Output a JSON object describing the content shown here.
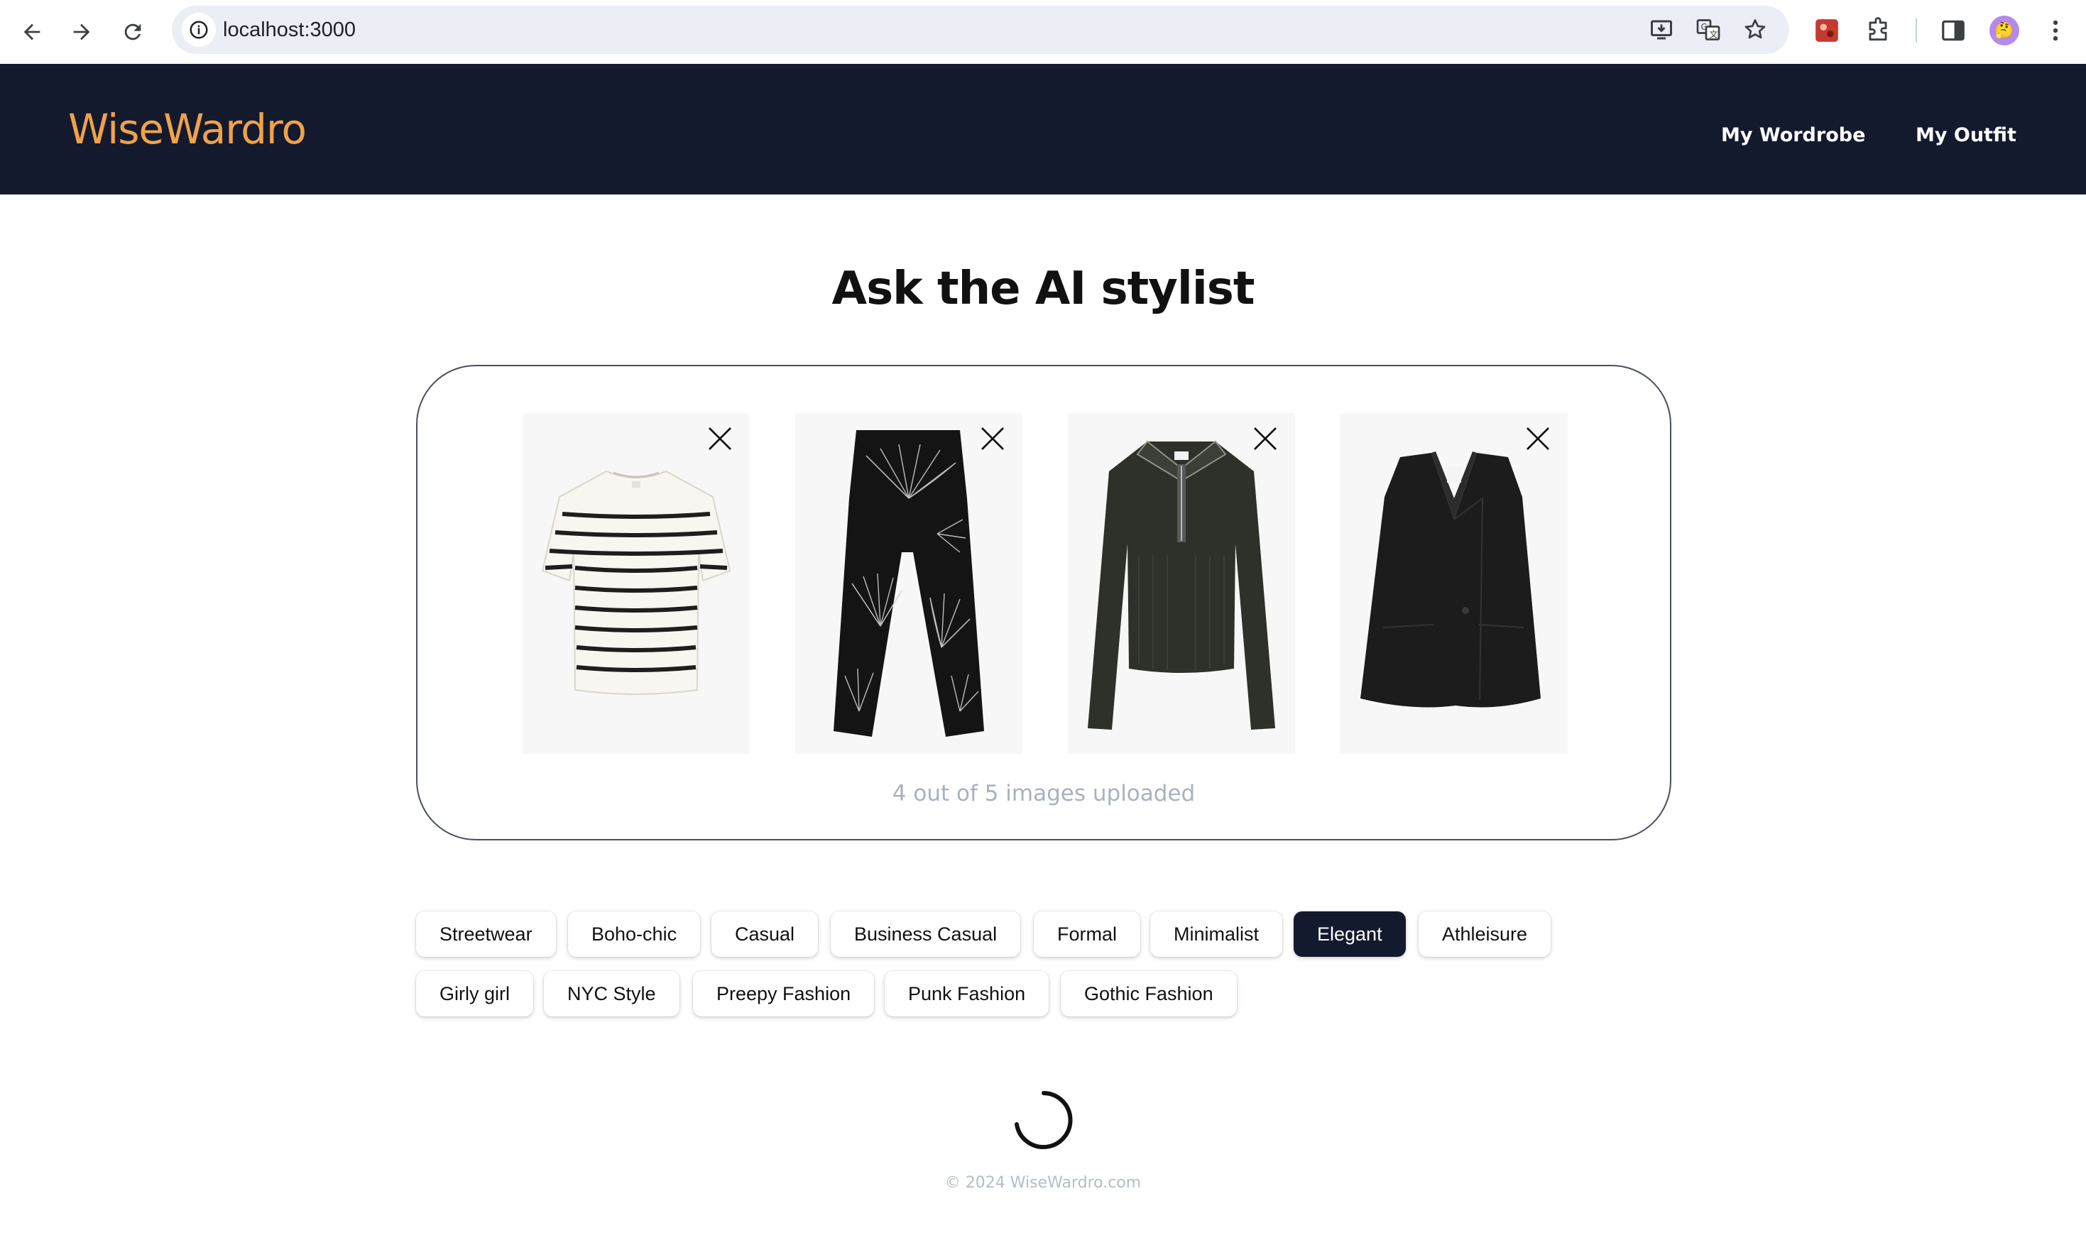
{
  "browser": {
    "url": "localhost:3000",
    "back_icon": "arrow-left-icon",
    "forward_icon": "arrow-right-icon",
    "reload_icon": "reload-icon",
    "site_info_icon": "info-icon",
    "install_icon": "install-app-icon",
    "translate_icon": "translate-icon",
    "bookmark_icon": "star-icon",
    "extension_icon": "puzzle-icon",
    "sidepanel_icon": "side-panel-icon",
    "menu_icon": "kebab-menu-icon",
    "profile_avatar": "🤔"
  },
  "header": {
    "brand": "WiseWardro",
    "brand_color": "#f0a24a",
    "background": "#141a2e",
    "nav": [
      "My Wordrobe",
      "My Outfit"
    ]
  },
  "main": {
    "title": "Ask the AI stylist",
    "uploaded_items": [
      {
        "name": "striped-knit-tshirt",
        "remove_icon": "close-icon"
      },
      {
        "name": "patterned-wide-trousers",
        "remove_icon": "close-icon"
      },
      {
        "name": "zip-polo-knit-sweater",
        "remove_icon": "close-icon"
      },
      {
        "name": "tailored-vest",
        "remove_icon": "close-icon"
      }
    ],
    "upload_status": "4 out of 5 images uploaded",
    "styles": [
      "Streetwear",
      "Boho-chic",
      "Casual",
      "Business Casual",
      "Formal",
      "Minimalist",
      "Elegant",
      "Athleisure",
      "Girly girl",
      "NYC Style",
      "Preepy Fashion",
      "Punk Fashion",
      "Gothic Fashion"
    ],
    "selected_style": "Elegant",
    "loading_icon": "spinner-icon"
  },
  "footer": {
    "text": "© 2024 WiseWardro.com"
  }
}
